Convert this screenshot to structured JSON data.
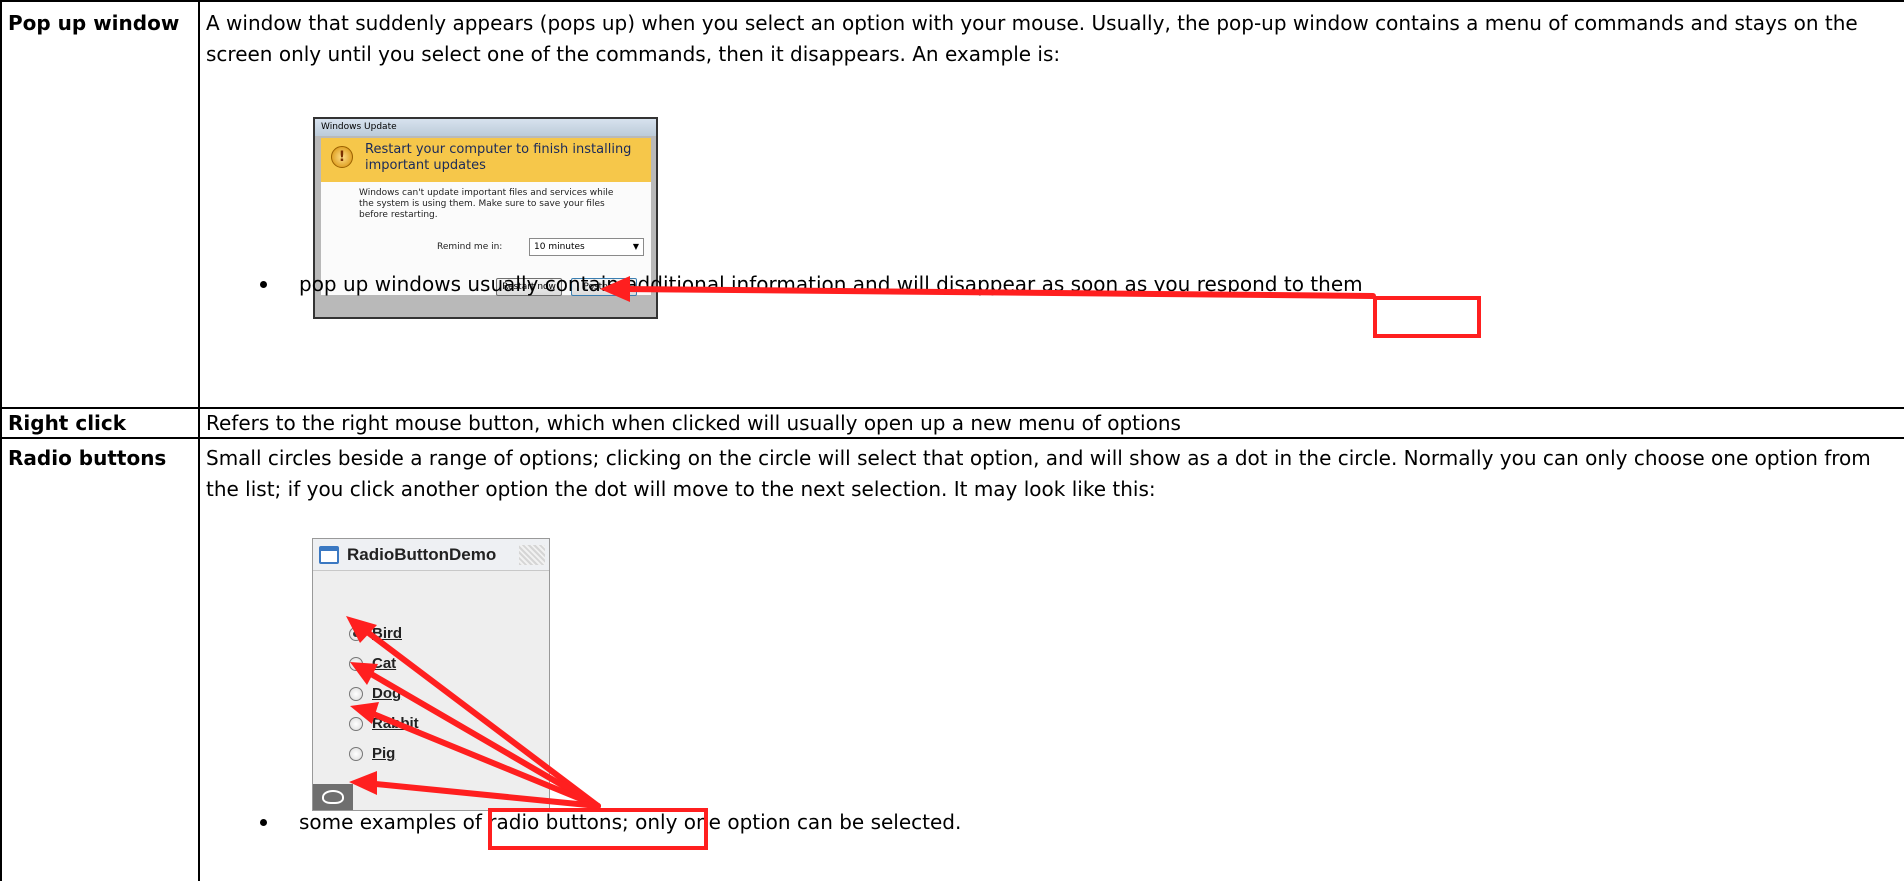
{
  "rows": [
    {
      "term": "Pop up window",
      "definition": "A window that suddenly appears (pops up) when you select an option with your mouse. Usually, the pop-up window contains a menu of commands and stays on the screen only until you select one of the commands, then it disappears. An example is:",
      "bullet": "pop up windows usually contain additional information and will disappear as soon as you respond to them"
    },
    {
      "term": "Right click",
      "definition": "Refers to the right mouse button, which when clicked will usually open up a new menu of options"
    },
    {
      "term": "Radio buttons",
      "definition": "Small circles beside a range of options; clicking on the circle will select that option, and will show as a dot in the circle. Normally you can only choose one option from the list; if you click another option the dot will move to the next selection. It may look like this:",
      "bullet": "some examples of radio buttons; only one option can be selected."
    }
  ],
  "popup_example": {
    "title": "Windows Update",
    "headline": "Restart your computer to finish installing important updates",
    "message": "Windows can't update important files and services while the system is using them. Make sure to save your files before restarting.",
    "remind_label": "Remind me in:",
    "remind_value": "10 minutes",
    "restart_button": "Restart now",
    "postpone_button": "Postpone"
  },
  "radio_example": {
    "title": "RadioButtonDemo",
    "options": [
      {
        "label": "Bird",
        "selected": true
      },
      {
        "label": "Cat",
        "selected": false
      },
      {
        "label": "Dog",
        "selected": false
      },
      {
        "label": "Rabbit",
        "selected": false
      },
      {
        "label": "Pig",
        "selected": false
      }
    ]
  },
  "annotation_color": "#ff1f1f"
}
